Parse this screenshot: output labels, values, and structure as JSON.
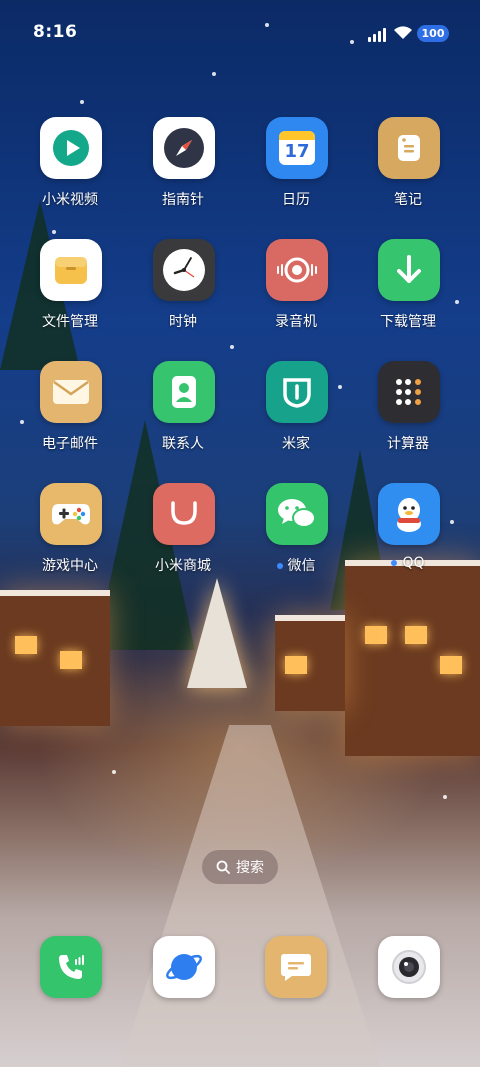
{
  "status_bar": {
    "time": "8:16",
    "battery": "100"
  },
  "apps": [
    {
      "name": "app-mi-video",
      "label": "小米视频",
      "icon": "play-icon",
      "bg": "#ffffff"
    },
    {
      "name": "app-compass",
      "label": "指南针",
      "icon": "compass-icon",
      "bg": "#ffffff"
    },
    {
      "name": "app-calendar",
      "label": "日历",
      "icon": "calendar-icon",
      "bg": "#2e88f0",
      "day": "17"
    },
    {
      "name": "app-notes",
      "label": "笔记",
      "icon": "notes-icon",
      "bg": "#d7a860"
    },
    {
      "name": "app-file-manager",
      "label": "文件管理",
      "icon": "folder-icon",
      "bg": "#ffffff"
    },
    {
      "name": "app-clock",
      "label": "时钟",
      "icon": "clock-icon",
      "bg": "#3a3a3c"
    },
    {
      "name": "app-recorder",
      "label": "录音机",
      "icon": "recorder-icon",
      "bg": "#d96a63"
    },
    {
      "name": "app-downloads",
      "label": "下载管理",
      "icon": "download-icon",
      "bg": "#36c46e"
    },
    {
      "name": "app-email",
      "label": "电子邮件",
      "icon": "mail-icon",
      "bg": "#e3b56e"
    },
    {
      "name": "app-contacts",
      "label": "联系人",
      "icon": "contacts-icon",
      "bg": "#36c46e"
    },
    {
      "name": "app-mi-home",
      "label": "米家",
      "icon": "mi-home-icon",
      "bg": "#17a28c"
    },
    {
      "name": "app-calculator",
      "label": "计算器",
      "icon": "calculator-icon",
      "bg": "#2d2d32"
    },
    {
      "name": "app-game-center",
      "label": "游戏中心",
      "icon": "gamepad-icon",
      "bg": "#e8b96a"
    },
    {
      "name": "app-mi-store",
      "label": "小米商城",
      "icon": "store-bag-icon",
      "bg": "#dd6b61"
    },
    {
      "name": "app-wechat",
      "label": "微信",
      "icon": "wechat-icon",
      "bg": "#34c46c",
      "badge_dot": true
    },
    {
      "name": "app-qq",
      "label": "QQ",
      "icon": "qq-penguin-icon",
      "bg": "#2f8ef0",
      "badge_dot": true
    }
  ],
  "dock": [
    {
      "name": "dock-phone",
      "icon": "phone-icon",
      "bg": "#34c46c"
    },
    {
      "name": "dock-browser",
      "icon": "browser-planet-icon",
      "bg": "#ffffff"
    },
    {
      "name": "dock-messages",
      "icon": "message-icon",
      "bg": "#e3b56e"
    },
    {
      "name": "dock-camera",
      "icon": "camera-icon",
      "bg": "#ffffff"
    }
  ],
  "search": {
    "label": "搜索",
    "icon": "search-icon"
  }
}
